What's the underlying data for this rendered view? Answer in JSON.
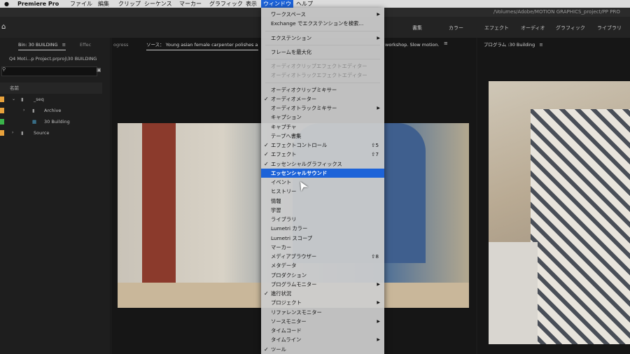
{
  "menubar": {
    "apple": "",
    "app": "Premiere Pro",
    "items": [
      "ファイル",
      "編集",
      "クリップ",
      "シーケンス",
      "マーカー",
      "グラフィック",
      "表示"
    ],
    "active": "ウィンドウ",
    "help": "ヘルプ"
  },
  "titlebar": {
    "path": "/Volumes/Adobe/MOTION GRAPHICS_project/PP PRO"
  },
  "workspaces": [
    "書集",
    "カラー",
    "エフェクト",
    "オーディオ",
    "グラフィック",
    "ライブラリ"
  ],
  "project": {
    "tab": "Bin: 30 BUILDING",
    "tab2": "Effec",
    "path": "Q4 Moti...p Project.prproj\\30 BUILDING",
    "col_name": "名前",
    "items": [
      {
        "name": "_seq",
        "color": "#e8a23c"
      },
      {
        "name": "Archive",
        "color": "#e8a23c"
      },
      {
        "name": "30 Building",
        "color": "#3ab34a"
      },
      {
        "name": "Source",
        "color": "#e8a23c"
      }
    ]
  },
  "source": {
    "tab_left": "ogress",
    "label": "ソース：  Young asian female carpenter polishes a",
    "label_tail": "workshop. Slow motion."
  },
  "program": {
    "label": "プログラム :30 Building"
  },
  "menu": {
    "items": [
      {
        "label": "ワークスペース",
        "submenu": true
      },
      {
        "label": "Exchange でエクステンションを検索..."
      },
      {
        "sep": true
      },
      {
        "label": "エクステンション",
        "submenu": true
      },
      {
        "sep": true
      },
      {
        "label": "フレームを最大化"
      },
      {
        "sep": true
      },
      {
        "label": "オーディオクリップエフェクトエディター",
        "disabled": true
      },
      {
        "label": "オーディオトラックエフェクトエディター",
        "disabled": true
      },
      {
        "sep": true
      },
      {
        "label": "オーディオクリップミキサー"
      },
      {
        "label": "オーディオメーター",
        "checked": true
      },
      {
        "label": "オーディオトラックミキサー",
        "submenu": true
      },
      {
        "label": "キャプション"
      },
      {
        "label": "キャプチャ"
      },
      {
        "label": "テープへ書集"
      },
      {
        "label": "エフェクトコントロール",
        "checked": true,
        "shortcut": "⇧5"
      },
      {
        "label": "エフェクト",
        "checked": true,
        "shortcut": "⇧7"
      },
      {
        "label": "エッセンシャルグラフィックス",
        "checked": true
      },
      {
        "label": "エッセンシャルサウンド",
        "highlighted": true
      },
      {
        "label": "イベント"
      },
      {
        "label": "ヒストリー"
      },
      {
        "label": "情報"
      },
      {
        "label": "学習"
      },
      {
        "label": "ライブラリ"
      },
      {
        "label": "Lumetri カラー"
      },
      {
        "label": "Lumetri スコープ"
      },
      {
        "label": "マーカー"
      },
      {
        "label": "メディアブラウザー",
        "shortcut": "⇧8"
      },
      {
        "label": "メタデータ"
      },
      {
        "label": "プロダクション"
      },
      {
        "label": "プログラムモニター",
        "submenu": true
      },
      {
        "label": "進行状況",
        "checked": true
      },
      {
        "label": "プロジェクト",
        "submenu": true
      },
      {
        "label": "リファレンスモニター"
      },
      {
        "label": "ソースモニター",
        "submenu": true
      },
      {
        "label": "タイムコード"
      },
      {
        "label": "タイムライン",
        "submenu": true
      },
      {
        "label": "ツール",
        "checked": true
      }
    ]
  },
  "colors": {
    "accent": "#1d63d8",
    "bin_orange": "#e8a23c",
    "seq_green": "#3ab34a"
  }
}
